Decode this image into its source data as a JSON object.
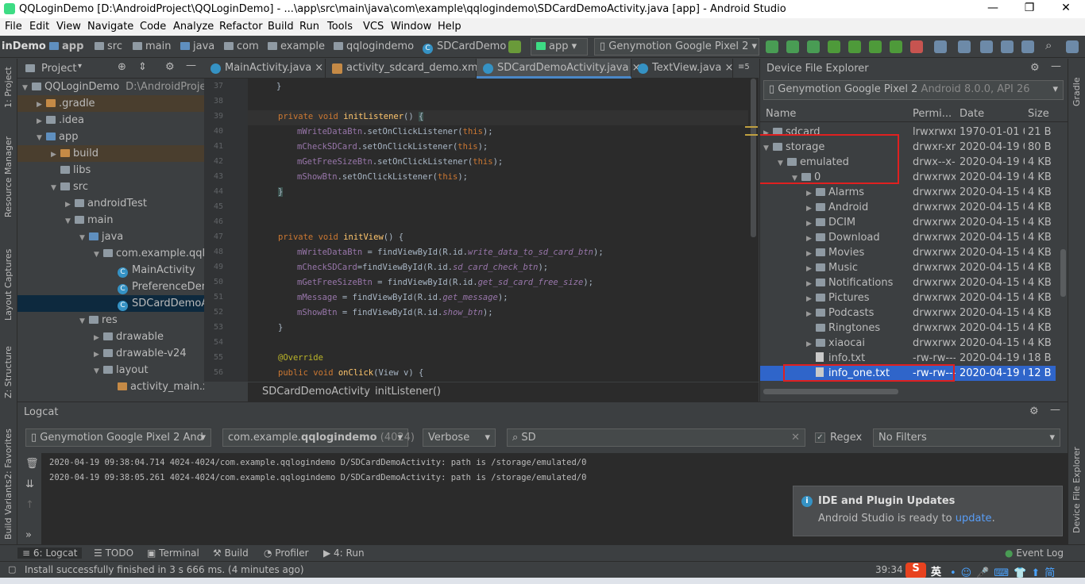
{
  "window": {
    "title": "QQLoginDemo [D:\\AndroidProject\\QQLoginDemo] - ...\\app\\src\\main\\java\\com\\example\\qqlogindemo\\SDCardDemoActivity.java [app] - Android Studio",
    "minimize": "—",
    "maximize": "❐",
    "close": "✕"
  },
  "menu": [
    "File",
    "Edit",
    "View",
    "Navigate",
    "Code",
    "Analyze",
    "Refactor",
    "Build",
    "Run",
    "Tools",
    "VCS",
    "Window",
    "Help"
  ],
  "nav": {
    "crumbs": [
      "inDemo",
      "app",
      "src",
      "main",
      "java",
      "com",
      "example",
      "qqlogindemo",
      "SDCardDemo"
    ],
    "run_config": "app",
    "device": "Genymotion Google Pixel 2"
  },
  "left_strip": {
    "project": "1: Project",
    "resource_manager": "Resource Manager",
    "layout_captures": "Layout Captures",
    "structure": "Z: Structure",
    "favorites": "2: Favorites",
    "build_variants": "Build Variants"
  },
  "project_panel": {
    "title": "Project",
    "tree": [
      {
        "label": "QQLoginDemo",
        "extra": "D:\\AndroidProject\\QQLoginDemo",
        "indent": 0,
        "arrow": "▼",
        "icon": "folder"
      },
      {
        "label": ".gradle",
        "indent": 1,
        "arrow": "▶",
        "icon": "folder-orange"
      },
      {
        "label": ".idea",
        "indent": 1,
        "arrow": "▶",
        "icon": "folder"
      },
      {
        "label": "app",
        "indent": 1,
        "arrow": "▼",
        "icon": "folder-blue"
      },
      {
        "label": "build",
        "indent": 2,
        "arrow": "▶",
        "icon": "folder-orange"
      },
      {
        "label": "libs",
        "indent": 2,
        "arrow": "",
        "icon": "folder"
      },
      {
        "label": "src",
        "indent": 2,
        "arrow": "▼",
        "icon": "folder"
      },
      {
        "label": "androidTest",
        "indent": 3,
        "arrow": "▶",
        "icon": "folder"
      },
      {
        "label": "main",
        "indent": 3,
        "arrow": "▼",
        "icon": "folder"
      },
      {
        "label": "java",
        "indent": 4,
        "arrow": "▼",
        "icon": "folder-blue"
      },
      {
        "label": "com.example.qqlogindemo",
        "indent": 5,
        "arrow": "▼",
        "icon": "folder"
      },
      {
        "label": "MainActivity",
        "indent": 6,
        "arrow": "",
        "icon": "class"
      },
      {
        "label": "PreferenceDemoActivity",
        "indent": 6,
        "arrow": "",
        "icon": "class"
      },
      {
        "label": "SDCardDemoActivity",
        "indent": 6,
        "arrow": "",
        "icon": "class"
      },
      {
        "label": "res",
        "indent": 4,
        "arrow": "▼",
        "icon": "folder"
      },
      {
        "label": "drawable",
        "indent": 5,
        "arrow": "▶",
        "icon": "folder"
      },
      {
        "label": "drawable-v24",
        "indent": 5,
        "arrow": "▶",
        "icon": "folder"
      },
      {
        "label": "layout",
        "indent": 5,
        "arrow": "▼",
        "icon": "folder"
      },
      {
        "label": "activity_main.xml",
        "indent": 6,
        "arrow": "",
        "icon": "xml"
      }
    ]
  },
  "editor": {
    "tabs": [
      {
        "label": "MainActivity.java",
        "color": "#3592c4"
      },
      {
        "label": "activity_sdcard_demo.xml",
        "color": "#c58a46"
      },
      {
        "label": "SDCardDemoActivity.java",
        "color": "#3592c4"
      },
      {
        "label": "TextView.java",
        "color": "#3592c4"
      }
    ],
    "tab_overflow": "≡5",
    "breadcrumb": [
      "SDCardDemoActivity",
      "initListener()"
    ],
    "line_numbers": [
      "37",
      "38",
      "39",
      "40",
      "41",
      "42",
      "43",
      "44",
      "45",
      "46",
      "47",
      "48",
      "49",
      "50",
      "51",
      "52",
      "53",
      "54",
      "55",
      "56"
    ]
  },
  "dfe": {
    "title": "Device File Explorer",
    "device": "Genymotion Google Pixel 2",
    "device_suffix": "Android 8.0.0, API 26",
    "columns": [
      "Name",
      "Permi...",
      "Date",
      "Size"
    ],
    "rows": [
      {
        "name": "sdcard",
        "perm": "lrwxrwxrw",
        "date": "1970-01-01 0(",
        "size": "21 B",
        "indent": 0,
        "arrow": "▶",
        "kind": "link"
      },
      {
        "name": "storage",
        "perm": "drwxr-xr-",
        "date": "2020-04-19 0",
        "size": "80 B",
        "indent": 0,
        "arrow": "▼",
        "kind": "folder"
      },
      {
        "name": "emulated",
        "perm": "drwx--x--",
        "date": "2020-04-19 0",
        "size": "4 KB",
        "indent": 1,
        "arrow": "▼",
        "kind": "folder"
      },
      {
        "name": "0",
        "perm": "drwxrwx-",
        "date": "2020-04-19 0",
        "size": "4 KB",
        "indent": 2,
        "arrow": "▼",
        "kind": "folder"
      },
      {
        "name": "Alarms",
        "perm": "drwxrwx-",
        "date": "2020-04-15 0!",
        "size": "4 KB",
        "indent": 3,
        "arrow": "▶",
        "kind": "folder"
      },
      {
        "name": "Android",
        "perm": "drwxrwx-",
        "date": "2020-04-15 0!",
        "size": "4 KB",
        "indent": 3,
        "arrow": "▶",
        "kind": "folder"
      },
      {
        "name": "DCIM",
        "perm": "drwxrwx-",
        "date": "2020-04-15 0!",
        "size": "4 KB",
        "indent": 3,
        "arrow": "▶",
        "kind": "folder"
      },
      {
        "name": "Download",
        "perm": "drwxrwx-",
        "date": "2020-04-15 0!",
        "size": "4 KB",
        "indent": 3,
        "arrow": "▶",
        "kind": "folder"
      },
      {
        "name": "Movies",
        "perm": "drwxrwx-",
        "date": "2020-04-15 0!",
        "size": "4 KB",
        "indent": 3,
        "arrow": "▶",
        "kind": "folder"
      },
      {
        "name": "Music",
        "perm": "drwxrwx-",
        "date": "2020-04-15 0!",
        "size": "4 KB",
        "indent": 3,
        "arrow": "▶",
        "kind": "folder"
      },
      {
        "name": "Notifications",
        "perm": "drwxrwx-",
        "date": "2020-04-15 0!",
        "size": "4 KB",
        "indent": 3,
        "arrow": "▶",
        "kind": "folder"
      },
      {
        "name": "Pictures",
        "perm": "drwxrwx-",
        "date": "2020-04-15 0!",
        "size": "4 KB",
        "indent": 3,
        "arrow": "▶",
        "kind": "folder"
      },
      {
        "name": "Podcasts",
        "perm": "drwxrwx-",
        "date": "2020-04-15 0!",
        "size": "4 KB",
        "indent": 3,
        "arrow": "▶",
        "kind": "folder"
      },
      {
        "name": "Ringtones",
        "perm": "drwxrwx-",
        "date": "2020-04-15 0!",
        "size": "4 KB",
        "indent": 3,
        "arrow": "",
        "kind": "folder"
      },
      {
        "name": "xiaocai",
        "perm": "drwxrwx-",
        "date": "2020-04-15 0!",
        "size": "4 KB",
        "indent": 3,
        "arrow": "▶",
        "kind": "folder"
      },
      {
        "name": "info.txt",
        "perm": "-rw-rw---",
        "date": "2020-04-19 0",
        "size": "18 B",
        "indent": 3,
        "arrow": "",
        "kind": "file"
      },
      {
        "name": "info_one.txt",
        "perm": "-rw-rw---",
        "date": "2020-04-19 0",
        "size": "12 B",
        "indent": 3,
        "arrow": "",
        "kind": "file"
      }
    ]
  },
  "logcat": {
    "title": "Logcat",
    "device": "Genymotion Google Pixel 2 And",
    "process_prefix": "com.example.",
    "process_bold": "qqlogindemo",
    "process_pid": "(4024)",
    "level": "Verbose",
    "search": "SD",
    "regex_label": "Regex",
    "filter": "No Filters",
    "lines": [
      "2020-04-19 09:38:04.714 4024-4024/com.example.qqlogindemo D/SDCardDemoActivity: path is /storage/emulated/0",
      "2020-04-19 09:38:05.261 4024-4024/com.example.qqlogindemo D/SDCardDemoActivity: path is /storage/emulated/0"
    ]
  },
  "notification": {
    "title": "IDE and Plugin Updates",
    "body": "Android Studio is ready to",
    "link": "update",
    "end": "."
  },
  "bottom_tabs": {
    "logcat": "6: Logcat",
    "todo": "TODO",
    "terminal": "Terminal",
    "build": "Build",
    "profiler": "Profiler",
    "run": "4: Run",
    "event_log": "Event Log"
  },
  "status": {
    "message": "Install successfully finished in 3 s 666 ms. (4 minutes ago)",
    "position": "39:34",
    "ime": "英"
  },
  "right_strip": {
    "gradle": "Gradle",
    "dfe": "Device File Explorer"
  }
}
